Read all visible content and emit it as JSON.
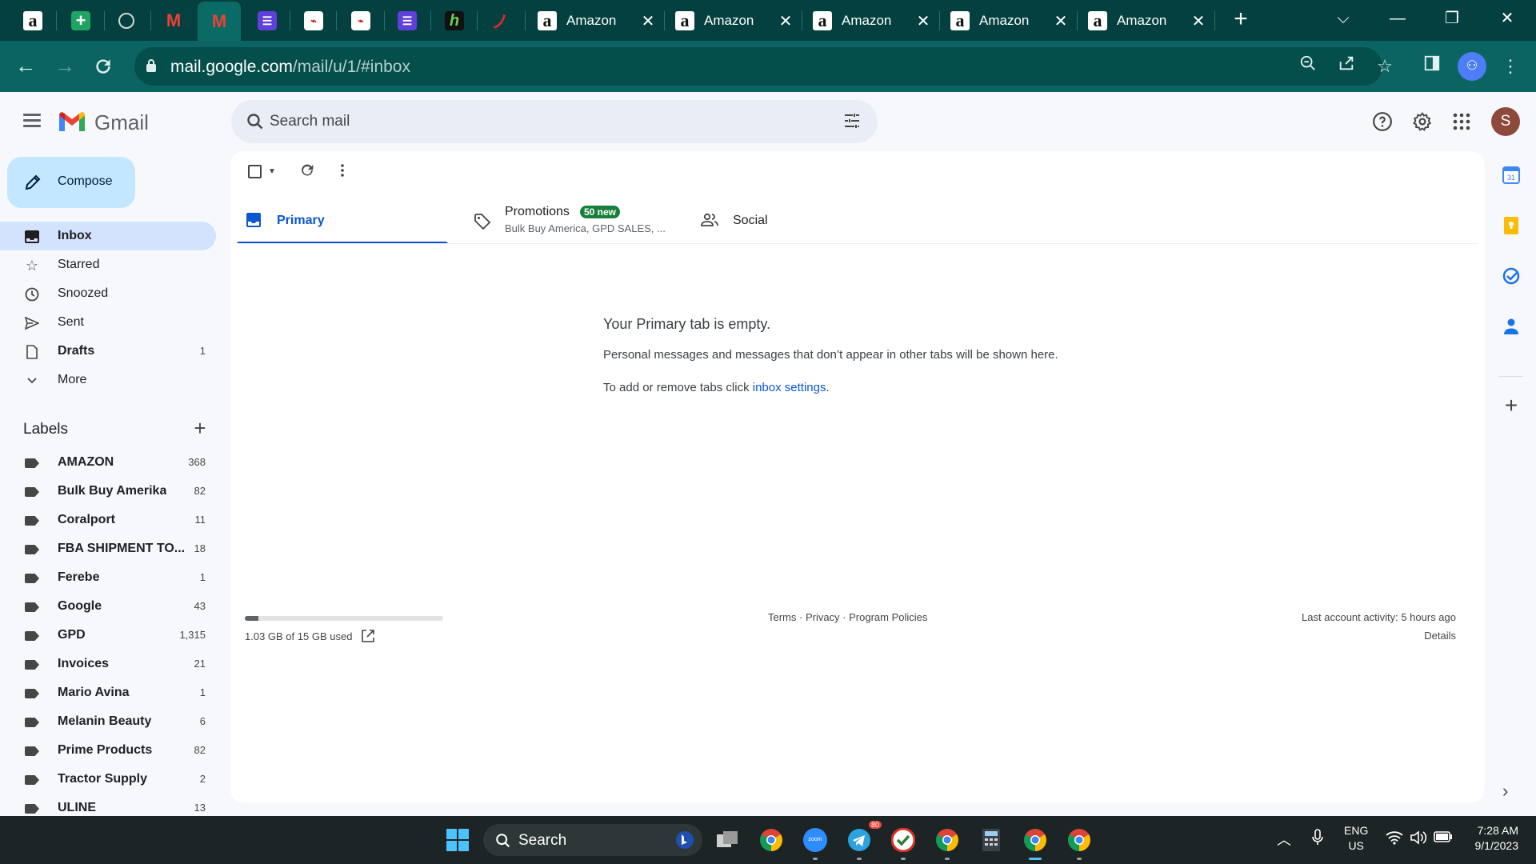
{
  "browser": {
    "pinned_tabs": [
      {
        "name": "amazon-tab",
        "glyph": "a"
      },
      {
        "name": "sheets-tab",
        "glyph": "+"
      },
      {
        "name": "globe-tab",
        "glyph": ""
      },
      {
        "name": "gmail-tab-1",
        "glyph": "M"
      },
      {
        "name": "gmail-tab-2",
        "glyph": "M"
      },
      {
        "name": "list-tab-1",
        "glyph": "☰"
      },
      {
        "name": "doc-tab-1",
        "glyph": "⌁"
      },
      {
        "name": "doc-tab-2",
        "glyph": "⌁"
      },
      {
        "name": "list-tab-2",
        "glyph": "☰"
      },
      {
        "name": "h-tab",
        "glyph": "h"
      },
      {
        "name": "swoosh-tab",
        "glyph": "ノ"
      }
    ],
    "tabs": [
      {
        "title": "Amazon"
      },
      {
        "title": "Amazon"
      },
      {
        "title": "Amazon"
      },
      {
        "title": "Amazon"
      },
      {
        "title": "Amazon"
      }
    ],
    "url_host": "mail.google.com",
    "url_path": "/mail/u/1/#inbox"
  },
  "gmail": {
    "product_name": "Gmail",
    "search_placeholder": "Search mail",
    "avatar_initial": "S",
    "compose_label": "Compose",
    "nav": [
      {
        "label": "Inbox",
        "count": ""
      },
      {
        "label": "Starred",
        "count": ""
      },
      {
        "label": "Snoozed",
        "count": ""
      },
      {
        "label": "Sent",
        "count": ""
      },
      {
        "label": "Drafts",
        "count": "1"
      },
      {
        "label": "More",
        "count": ""
      }
    ],
    "labels_heading": "Labels",
    "labels": [
      {
        "label": "AMAZON",
        "count": "368"
      },
      {
        "label": "Bulk Buy Amerika",
        "count": "82"
      },
      {
        "label": "Coralport",
        "count": "11"
      },
      {
        "label": "FBA SHIPMENT TO...",
        "count": "18"
      },
      {
        "label": "Ferebe",
        "count": "1"
      },
      {
        "label": "Google",
        "count": "43"
      },
      {
        "label": "GPD",
        "count": "1,315"
      },
      {
        "label": "Invoices",
        "count": "21"
      },
      {
        "label": "Mario Avina",
        "count": "1"
      },
      {
        "label": "Melanin Beauty",
        "count": "6"
      },
      {
        "label": "Prime Products",
        "count": "82"
      },
      {
        "label": "Tractor Supply",
        "count": "2"
      },
      {
        "label": "ULINE",
        "count": "13"
      }
    ],
    "tabs": {
      "primary": "Primary",
      "promotions": "Promotions",
      "promotions_badge": "50 new",
      "promotions_snippet": "Bulk Buy America, GPD SALES, ...",
      "social": "Social"
    },
    "empty": {
      "title": "Your Primary tab is empty.",
      "desc": "Personal messages and messages that don’t appear in other tabs will be shown here.",
      "hint_prefix": "To add or remove tabs click ",
      "hint_link": "inbox settings",
      "hint_suffix": "."
    },
    "footer": {
      "storage_text": "1.03 GB of 15 GB used",
      "storage_fraction": 0.069,
      "links": "Terms · Privacy · Program Policies",
      "activity": "Last account activity: 5 hours ago",
      "details": "Details"
    }
  },
  "taskbar": {
    "search_label": "Search",
    "lang_top": "ENG",
    "lang_bottom": "US",
    "time": "7:28 AM",
    "date": "9/1/2023",
    "telegram_badge": "80"
  },
  "colors": {
    "tab_strip": "#03403f",
    "toolbar": "#0b6461",
    "accent_blue": "#0b57d0",
    "compose_bg": "#c2e7ff",
    "badge_green": "#188038"
  }
}
